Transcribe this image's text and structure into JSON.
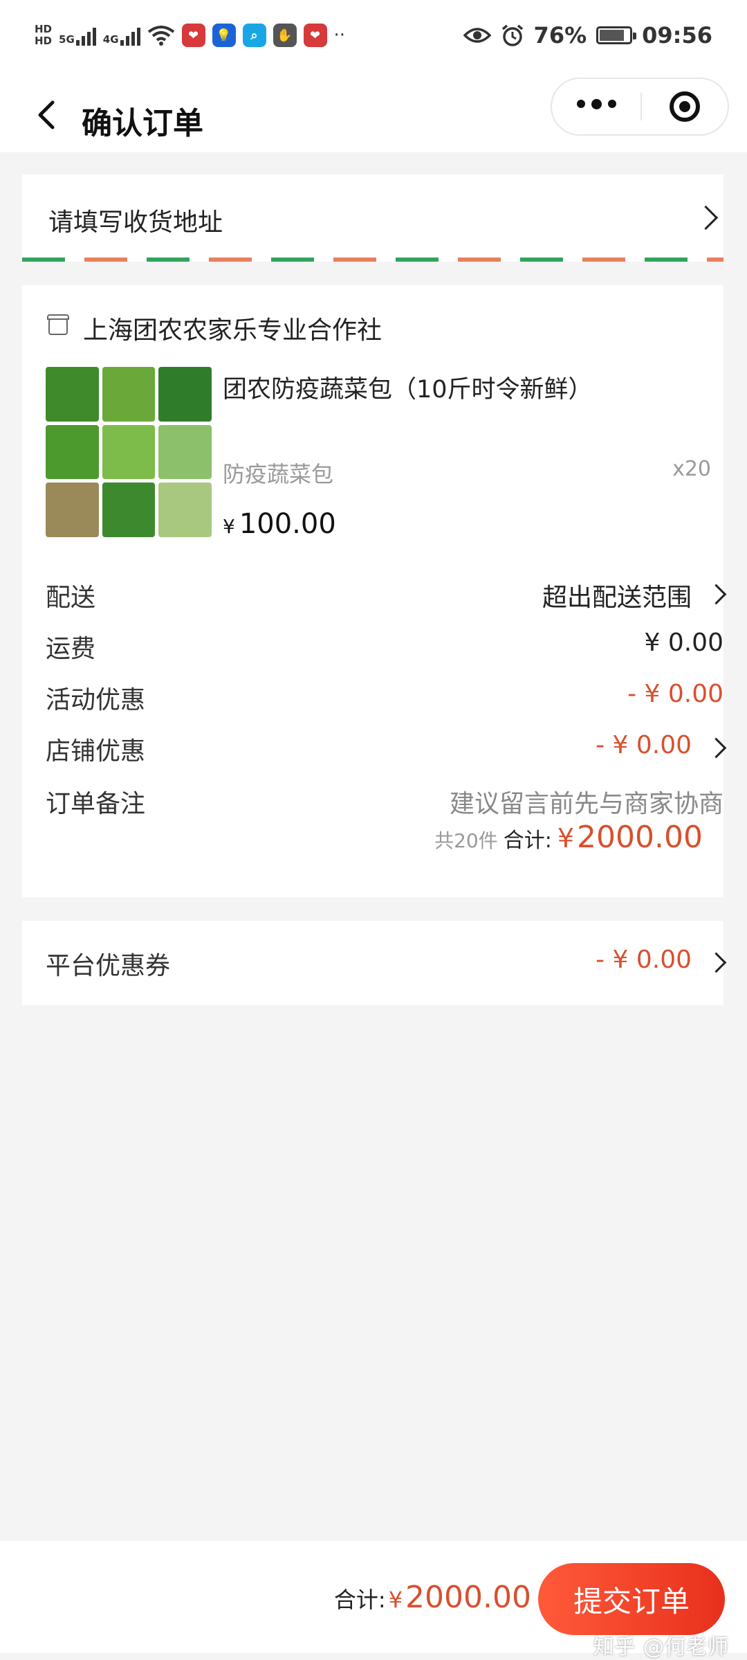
{
  "status_bar": {
    "hd_top": "HD",
    "hd_bottom": "HD",
    "net1": "5G",
    "net2": "4G",
    "more": "··",
    "battery_text": "76%",
    "battery_level": 0.76,
    "time": "09:56"
  },
  "nav": {
    "title": "确认订单"
  },
  "address": {
    "prompt": "请填写收货地址"
  },
  "order": {
    "shop_name": "上海团农农家乐专业合作社",
    "product": {
      "name": "团农防疫蔬菜包（10斤时令新鲜）",
      "spec": "防疫蔬菜包",
      "qty": "x20",
      "currency": "¥",
      "price": "100.00"
    },
    "rows": [
      {
        "label": "配送",
        "value": "超出配送范围"
      },
      {
        "label": "运费",
        "value": "¥ 0.00"
      },
      {
        "label": "活动优惠",
        "value": "- ¥ 0.00"
      },
      {
        "label": "店铺优惠",
        "value": "- ¥ 0.00"
      },
      {
        "label": "订单备注",
        "value": "建议留言前先与商家协商"
      }
    ],
    "count_text": "共20件",
    "total_label": "合计:",
    "total_currency": "¥",
    "total_amount": "2000.00"
  },
  "coupon": {
    "label": "平台优惠券",
    "value": "- ¥ 0.00"
  },
  "bottom": {
    "total_label": "合计:",
    "currency": "¥",
    "amount": "2000.00",
    "submit_label": "提交订单"
  },
  "watermark": "知乎 @何老师",
  "colors": {
    "accent_red": "#d8502e",
    "stripe_green": "#2fa55b",
    "stripe_orange": "#e8805a"
  }
}
